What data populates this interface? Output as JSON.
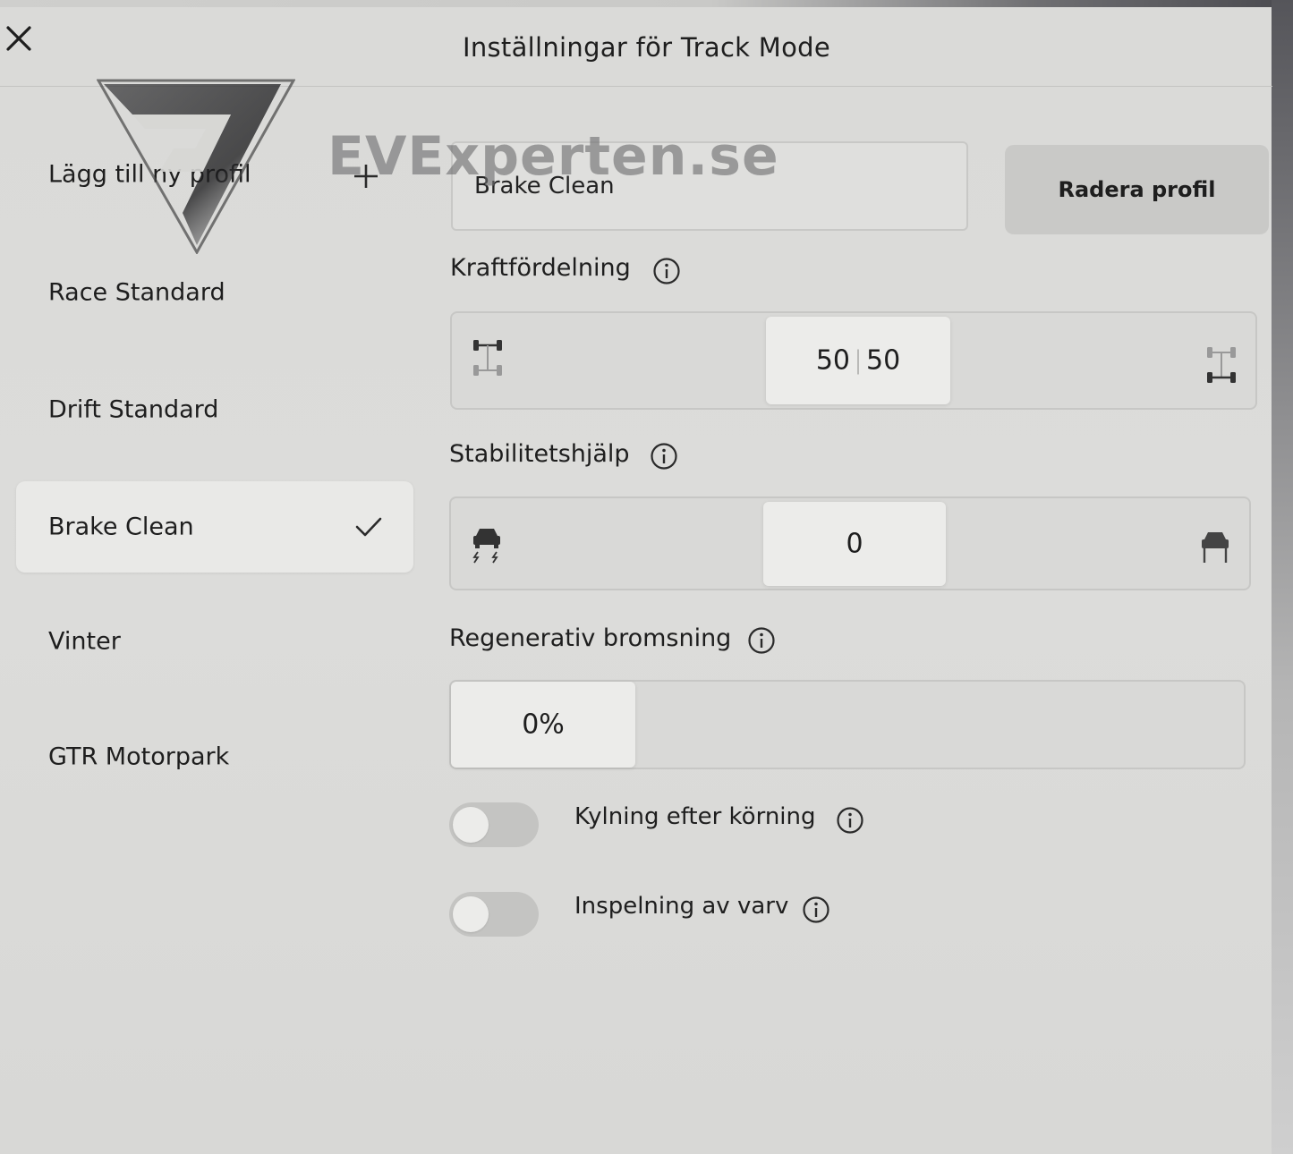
{
  "header": {
    "title": "Inställningar för Track Mode"
  },
  "watermark": {
    "text": "EVExperten.se",
    "logo_icon": "evexperten-logo"
  },
  "profiles": {
    "add_label": "Lägg till ny profil",
    "items": [
      {
        "label": "Race Standard",
        "selected": false
      },
      {
        "label": "Drift Standard",
        "selected": false
      },
      {
        "label": "Brake Clean",
        "selected": true
      },
      {
        "label": "Vinter",
        "selected": false
      },
      {
        "label": "GTR Motorpark",
        "selected": false
      }
    ]
  },
  "editor": {
    "profile_name": "Brake Clean",
    "delete_label": "Radera profil",
    "power_distribution": {
      "label": "Kraftfördelning",
      "front": "50",
      "rear": "50",
      "position_fraction": 0.5
    },
    "stability_assist": {
      "label": "Stabilitetshjälp",
      "value": "0",
      "position_fraction": 0.5
    },
    "regen_braking": {
      "label": "Regenerativ bromsning",
      "value": "0%",
      "fill_fraction": 0
    },
    "toggles": [
      {
        "label": "Kylning efter körning",
        "on": false
      },
      {
        "label": "Inspelning av varv",
        "on": false
      }
    ]
  },
  "colors": {
    "background": "#d8d8d6",
    "selected_row": "#e9e9e7",
    "knob": "#ececea",
    "text": "#1e1e1e"
  }
}
